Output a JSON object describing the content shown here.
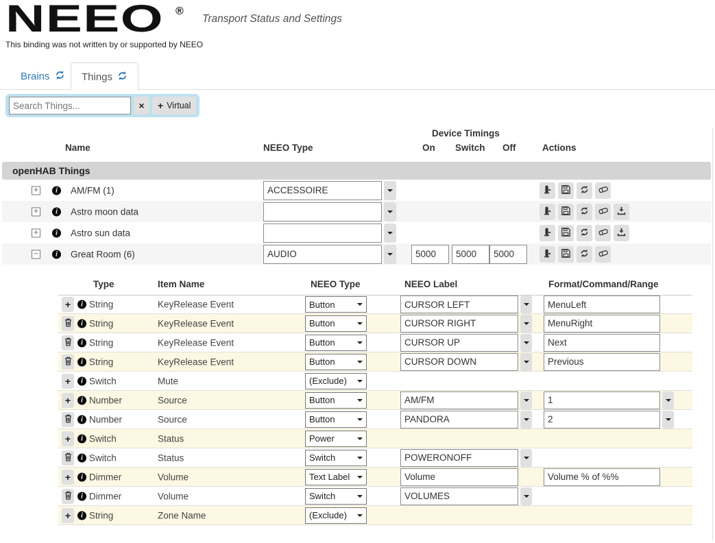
{
  "header": {
    "logo": "NEEO",
    "registered": "®",
    "subtitle": "Transport Status and Settings",
    "disclaimer": "This binding was not written by or supported by NEEO"
  },
  "tabs": [
    {
      "label": "Brains",
      "icon": "refresh-icon",
      "active": false
    },
    {
      "label": "Things",
      "icon": "refresh-icon",
      "active": true
    }
  ],
  "search": {
    "placeholder": "Search Things...",
    "clear_label": "×",
    "virtual_plus": "+",
    "virtual_label": "Virtual"
  },
  "things_table": {
    "section_header": "openHAB Things",
    "columns": {
      "name": "Name",
      "neeo_type": "NEEO Type",
      "device_timings": "Device Timings",
      "on": "On",
      "switch": "Switch",
      "off": "Off",
      "actions": "Actions"
    },
    "rows": [
      {
        "expand_glyph": "+",
        "name": "AM/FM (1)",
        "neeo_type": "ACCESSOIRE",
        "actions": [
          "device-icon",
          "save-icon",
          "refresh-icon",
          "eraser-icon"
        ]
      },
      {
        "expand_glyph": "+",
        "name": "Astro moon data",
        "neeo_type": "",
        "actions": [
          "device-icon",
          "save-icon",
          "refresh-icon",
          "eraser-icon",
          "download-icon"
        ]
      },
      {
        "expand_glyph": "+",
        "name": "Astro sun data",
        "neeo_type": "",
        "actions": [
          "device-icon",
          "save-icon",
          "refresh-icon",
          "eraser-icon",
          "download-icon"
        ]
      },
      {
        "expand_glyph": "−",
        "name": "Great Room (6)",
        "neeo_type": "AUDIO",
        "timing_on": "5000",
        "timing_switch": "5000",
        "timing_off": "5000",
        "actions": [
          "device-icon",
          "save-icon",
          "refresh-icon",
          "eraser-icon"
        ]
      }
    ]
  },
  "channels_table": {
    "columns": {
      "type": "Type",
      "item_name": "Item Name",
      "neeo_type": "NEEO Type",
      "neeo_label": "NEEO Label",
      "format": "Format/Command/Range"
    },
    "rows": [
      {
        "type": "String",
        "item_name": "KeyRelease Event",
        "neeo_type": "Button",
        "neeo_label": "CURSOR LEFT",
        "format": "MenuLeft"
      },
      {
        "type": "String",
        "item_name": "KeyRelease Event",
        "neeo_type": "Button",
        "neeo_label": "CURSOR RIGHT",
        "format": "MenuRight"
      },
      {
        "type": "String",
        "item_name": "KeyRelease Event",
        "neeo_type": "Button",
        "neeo_label": "CURSOR UP",
        "format": "Next"
      },
      {
        "type": "String",
        "item_name": "KeyRelease Event",
        "neeo_type": "Button",
        "neeo_label": "CURSOR DOWN",
        "format": "Previous"
      },
      {
        "type": "Switch",
        "item_name": "Mute",
        "neeo_type": "(Exclude)"
      },
      {
        "type": "Number",
        "item_name": "Source",
        "neeo_type": "Button",
        "neeo_label": "AM/FM",
        "format": "1"
      },
      {
        "type": "Number",
        "item_name": "Source",
        "neeo_type": "Button",
        "neeo_label": "PANDORA",
        "format": "2"
      },
      {
        "type": "Switch",
        "item_name": "Status",
        "neeo_type": "Power"
      },
      {
        "type": "Switch",
        "item_name": "Status",
        "neeo_type": "Switch",
        "neeo_label": "POWERONOFF"
      },
      {
        "type": "Dimmer",
        "item_name": "Volume",
        "neeo_type": "Text Label",
        "neeo_label": "Volume",
        "format": "Volume % of %%"
      },
      {
        "type": "Dimmer",
        "item_name": "Volume",
        "neeo_type": "Switch",
        "neeo_label": "VOLUMES"
      },
      {
        "type": "String",
        "item_name": "Zone Name",
        "neeo_type": "(Exclude)"
      }
    ]
  },
  "icons": {
    "tab_refresh": "refresh-icon (circular arrows)",
    "row_add": "plus-icon",
    "row_delete": "trash-icon",
    "info": "info-icon (black circle i)",
    "expand_collapsed": "plus-box-icon",
    "expand_expanded": "minus-box-icon",
    "dropdown": "caret-down-icon",
    "clear_search": "x-icon",
    "thing_actions": [
      "device-icon",
      "save-icon",
      "refresh-icon",
      "eraser-icon",
      "download-icon"
    ]
  },
  "colors": {
    "accent_blue": "#337ab7",
    "section_bar": "#d4d4d4",
    "thing_row_stripe": "#f5f5f5",
    "channel_row_alt": "#fcf8e3",
    "search_panel": "#bde1f0",
    "button_gray": "#e0e0e0"
  }
}
